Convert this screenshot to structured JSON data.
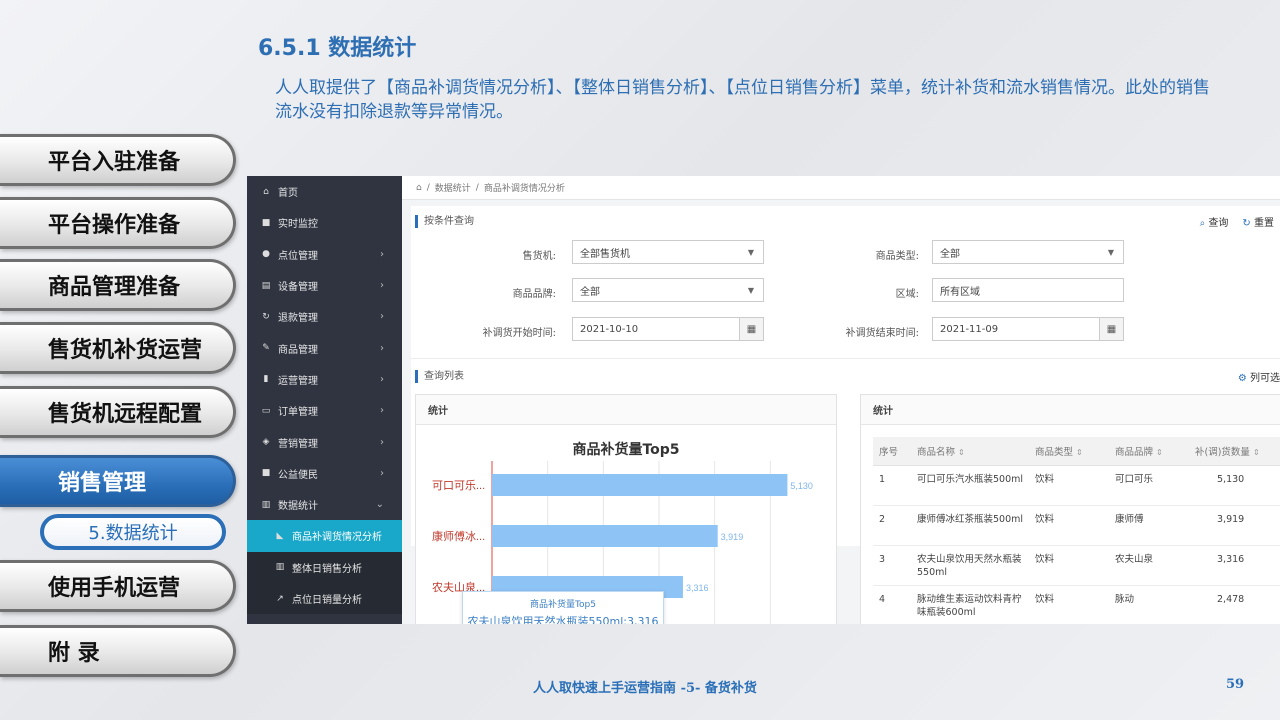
{
  "heading": "6.5.1 数据统计",
  "intro": "人人取提供了【商品补调货情况分析】、【整体日销售分析】、【点位日销售分析】菜单，统计补货和流水销售情况。此处的销售流水没有扣除退款等异常情况。",
  "chapters": [
    {
      "label": "平台入驻准备"
    },
    {
      "label": "平台操作准备"
    },
    {
      "label": "商品管理准备"
    },
    {
      "label": "售货机补货运营"
    },
    {
      "label": "售货机远程配置"
    },
    {
      "label": "销售管理"
    },
    {
      "label": "使用手机运营"
    },
    {
      "label": "附 录"
    }
  ],
  "subchapter": "5.数据统计",
  "screenshot": {
    "sidebar": [
      {
        "label": "首页",
        "icon": "home-icon",
        "glyph": "⌂"
      },
      {
        "label": "实时监控",
        "icon": "video-icon",
        "glyph": "■"
      },
      {
        "label": "点位管理",
        "icon": "map-pin-icon",
        "glyph": "●"
      },
      {
        "label": "设备管理",
        "icon": "device-icon",
        "glyph": "▤"
      },
      {
        "label": "退款管理",
        "icon": "refresh-icon",
        "glyph": "↻"
      },
      {
        "label": "商品管理",
        "icon": "edit-icon",
        "glyph": "✎"
      },
      {
        "label": "运营管理",
        "icon": "bookmark-icon",
        "glyph": "▮"
      },
      {
        "label": "订单管理",
        "icon": "card-icon",
        "glyph": "▭"
      },
      {
        "label": "营销管理",
        "icon": "gift-icon",
        "glyph": "◈"
      },
      {
        "label": "公益便民",
        "icon": "square-icon",
        "glyph": "■"
      },
      {
        "label": "数据统计",
        "icon": "bar-chart-icon",
        "glyph": "▥"
      }
    ],
    "subitems": [
      {
        "label": "商品补调货情况分析",
        "icon": "area-chart-icon",
        "glyph": "◣"
      },
      {
        "label": "整体日销售分析",
        "icon": "bar-chart-icon",
        "glyph": "▥"
      },
      {
        "label": "点位日销量分析",
        "icon": "line-chart-icon",
        "glyph": "↗"
      }
    ],
    "breadcrumb": {
      "home_glyph": "⌂",
      "sep": "/",
      "level1": "数据统计",
      "level2": "商品补调货情况分析"
    },
    "query_section": "按条件查询",
    "query_button": "查询",
    "reset_button": "重置",
    "form": {
      "machine_label": "售货机:",
      "machine_value": "全部售货机",
      "type_label": "商品类型:",
      "type_value": "全部",
      "brand_label": "商品品牌:",
      "brand_value": "全部",
      "area_label": "区域:",
      "area_value": "所有区域",
      "start_label": "补调货开始时间:",
      "start_value": "2021-10-10",
      "end_label": "补调货结束时间:",
      "end_value": "2021-11-09"
    },
    "list_section": "查询列表",
    "column_select": "列可选",
    "stats_card_title": "统计",
    "table_card_title": "统计",
    "tooltip": {
      "title": "商品补货量Top5",
      "text": "农夫山泉饮用天然水瓶装550ml:3,316"
    },
    "table": {
      "headers": [
        "序号",
        "商品名称",
        "商品类型",
        "商品品牌",
        "补(调)货数量"
      ],
      "rows": [
        {
          "no": "1",
          "name": "可口可乐汽水瓶装500ml",
          "type": "饮料",
          "brand": "可口可乐",
          "qty": "5,130"
        },
        {
          "no": "2",
          "name": "康师傅冰红茶瓶装500ml",
          "type": "饮料",
          "brand": "康师傅",
          "qty": "3,919"
        },
        {
          "no": "3",
          "name": "农夫山泉饮用天然水瓶装550ml",
          "type": "饮料",
          "brand": "农夫山泉",
          "qty": "3,316"
        },
        {
          "no": "4",
          "name": "脉动维生素运动饮料青柠味瓶装600ml",
          "type": "饮料",
          "brand": "脉动",
          "qty": "2,478"
        }
      ]
    }
  },
  "chart_data": {
    "type": "bar",
    "title": "商品补货量Top5",
    "orientation": "horizontal",
    "categories": [
      "可口可乐...",
      "康师傅冰...",
      "农夫山泉..."
    ],
    "values": [
      5130,
      3919,
      3316
    ],
    "value_labels": [
      "5,130",
      "3,919",
      "3,316"
    ],
    "xlim": [
      0,
      5800
    ],
    "grid": true,
    "bar_color": "#8ec3f5",
    "label_color": "#c0392b"
  },
  "footer": "人人取快速上手运营指南 -5- 备货补货",
  "page_number": "59",
  "colors": {
    "accent": "#2a6fb8",
    "sidebar_bg": "#2f3440",
    "active_sub": "#19a8c9"
  }
}
